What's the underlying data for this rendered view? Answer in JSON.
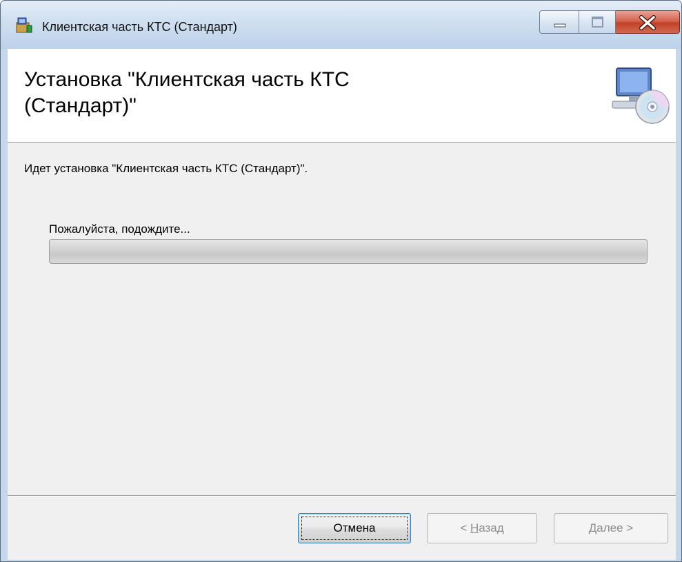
{
  "window": {
    "title": "Клиентская часть КТС (Стандарт)",
    "controls": {
      "minimize": "minimize",
      "maximize": "maximize",
      "close": "close"
    }
  },
  "banner": {
    "title_line1": "Установка \"Клиентская часть КТС",
    "title_line2": "(Стандарт)\""
  },
  "content": {
    "status_text": "Идет установка \"Клиентская часть КТС (Стандарт)\".",
    "wait_text": "Пожалуйста, подождите...",
    "progress_percent": 0
  },
  "buttons": {
    "cancel": "Отмена",
    "back_mnemonic": "Н",
    "back_rest": "азад",
    "back_prefix": "< ",
    "next_mnemonic": "Д",
    "next_rest": "алее >"
  },
  "colors": {
    "progress_fill": "#37b44a",
    "close_button": "#c14128"
  },
  "icons": {
    "title_icon": "installer-icon",
    "banner_icon": "computer-disc-icon"
  }
}
